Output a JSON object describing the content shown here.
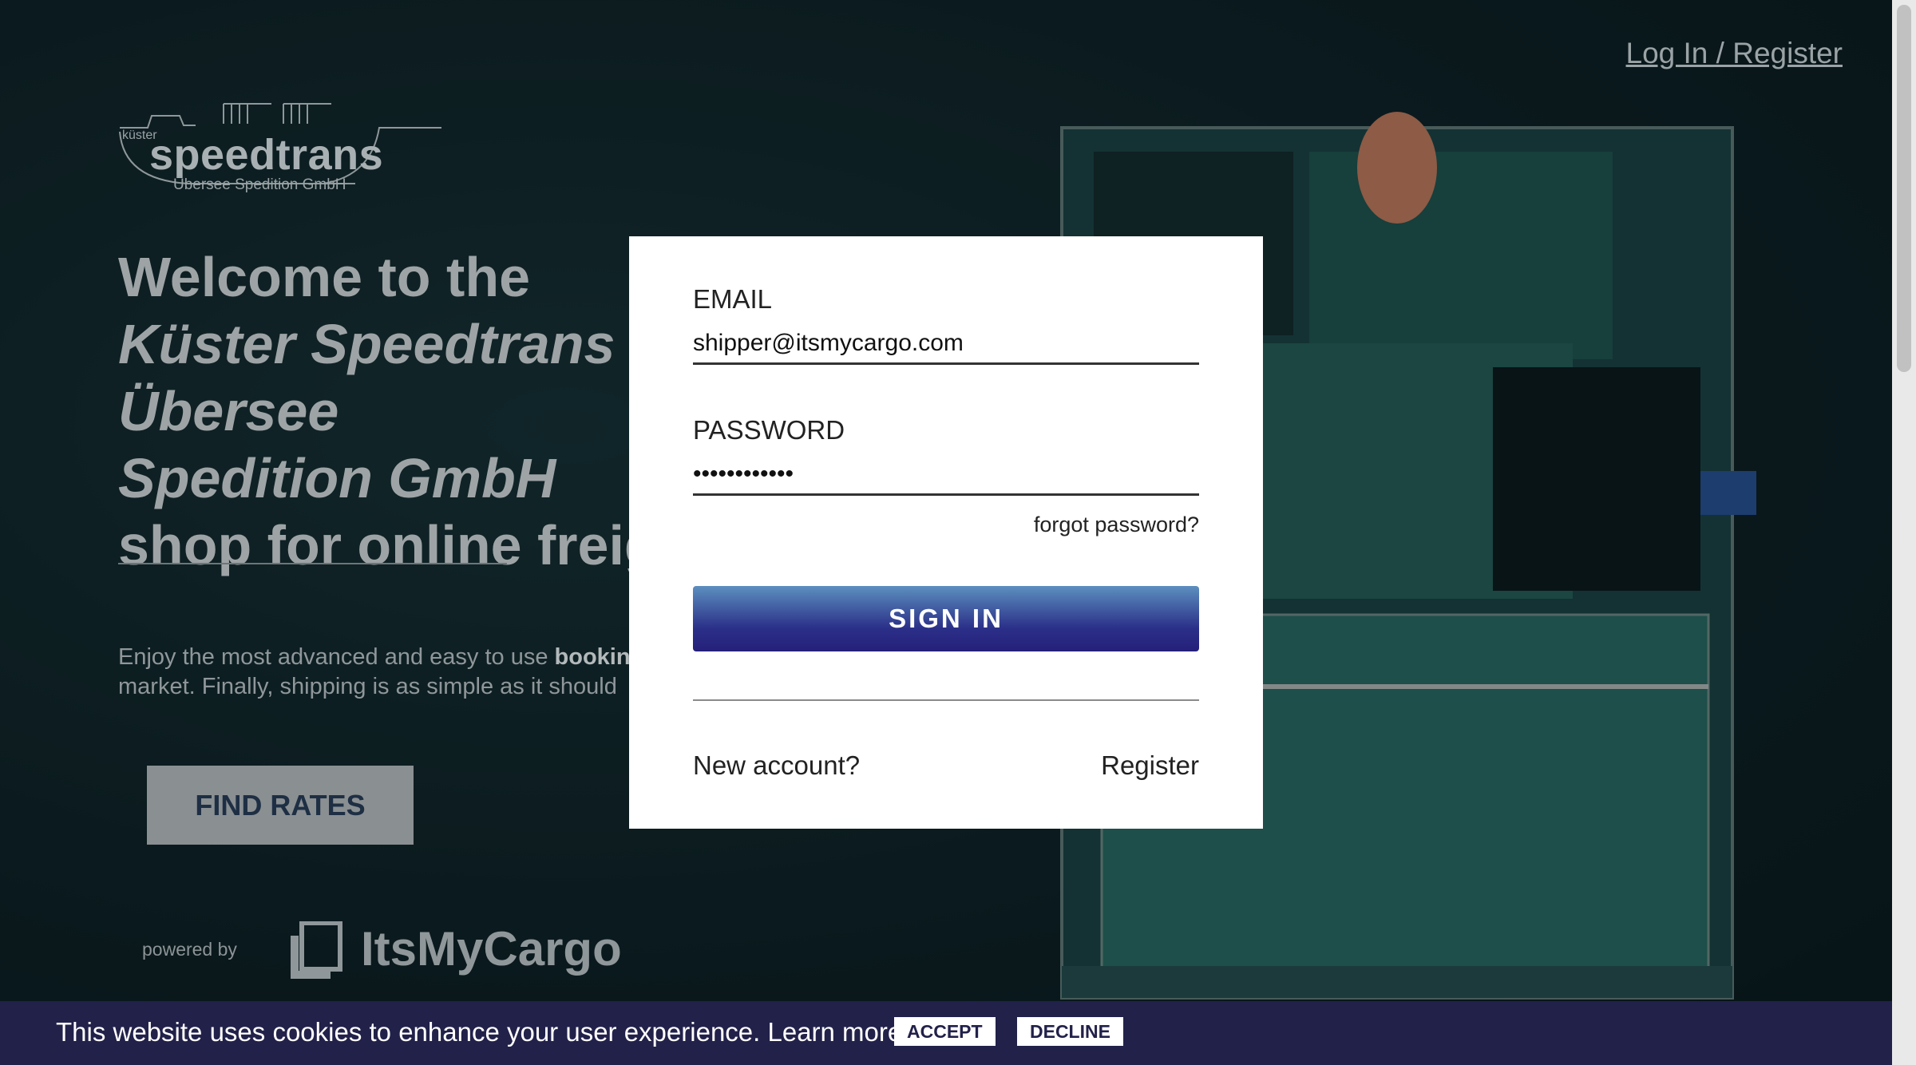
{
  "header": {
    "login_register": "Log In / Register"
  },
  "logo": {
    "small": "küster",
    "brand": "speedtrans",
    "sub": "Übersee Spedition GmbH"
  },
  "hero": {
    "line1": "Welcome to the",
    "line2": "Küster Speedtrans Übersee",
    "line3": "Spedition GmbH",
    "line4": "shop for online freight",
    "intro_prefix": "Enjoy the most advanced and easy to use ",
    "intro_bold": "booking",
    "intro_line2": "market. Finally, shipping is as simple as it should",
    "cta": "FIND RATES"
  },
  "powered": {
    "label": "powered by",
    "brand": "ItsMyCargo"
  },
  "login": {
    "email_label": "EMAIL",
    "email_value": "shipper@itsmycargo.com",
    "password_label": "PASSWORD",
    "password_value": "••••••••••••",
    "forgot": "forgot password?",
    "sign_in": "SIGN IN",
    "new_account": "New account?",
    "register": "Register"
  },
  "cookie": {
    "text": "This website uses cookies to enhance your user experience. Learn more",
    "accept": "ACCEPT",
    "decline": "DECLINE"
  },
  "colors": {
    "accent": "#2b2f88",
    "cookie_bar": "#22214a"
  }
}
